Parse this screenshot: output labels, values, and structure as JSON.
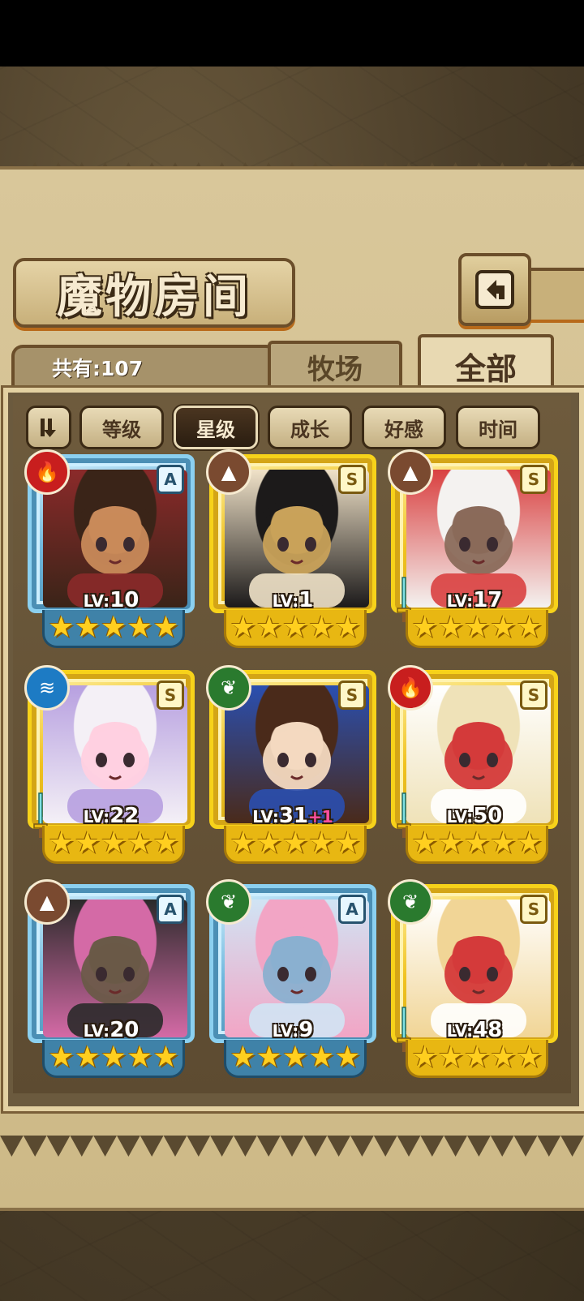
{
  "header": {
    "title": "魔物房间",
    "total_count": "共有:107"
  },
  "tabs": [
    {
      "label": "牧场",
      "active": false
    },
    {
      "label": "全部",
      "active": true
    }
  ],
  "sort_buttons": [
    {
      "label": "等级",
      "active": false
    },
    {
      "label": "星级",
      "active": true
    },
    {
      "label": "成长",
      "active": false
    },
    {
      "label": "好感",
      "active": false
    },
    {
      "label": "时间",
      "active": false
    }
  ],
  "stars_glyph": "★★★★★",
  "level_prefix": "LV:",
  "monsters": [
    {
      "level": "10",
      "bonus": "",
      "rank": "A",
      "element": "fire-icon",
      "frame": "blue",
      "has_weapon": false,
      "palette": [
        "#3a2418",
        "#8b2a2a",
        "#c98a5a"
      ]
    },
    {
      "level": "1",
      "bonus": "",
      "rank": "S",
      "element": "earth-icon",
      "frame": "gold",
      "has_weapon": false,
      "palette": [
        "#1c1a1a",
        "#f0e2c8",
        "#c9a25a"
      ]
    },
    {
      "level": "17",
      "bonus": "",
      "rank": "S",
      "element": "earth-icon",
      "frame": "gold",
      "has_weapon": true,
      "palette": [
        "#f4f2f0",
        "#d94040",
        "#8a6a5a"
      ]
    },
    {
      "level": "22",
      "bonus": "",
      "rank": "S",
      "element": "water-icon",
      "frame": "gold",
      "has_weapon": true,
      "palette": [
        "#f4f0f6",
        "#b7a0e0",
        "#ffd0e0"
      ]
    },
    {
      "level": "31",
      "bonus": "+1",
      "rank": "S",
      "element": "leaf-icon",
      "frame": "gold",
      "has_weapon": false,
      "palette": [
        "#4a2a1a",
        "#2a4fb0",
        "#f3d9c0"
      ]
    },
    {
      "level": "50",
      "bonus": "",
      "rank": "S",
      "element": "fire-icon",
      "frame": "gold",
      "has_weapon": true,
      "palette": [
        "#efe2b8",
        "#ffffff",
        "#d43a3a"
      ]
    },
    {
      "level": "20",
      "bonus": "",
      "rank": "A",
      "element": "earth-icon",
      "frame": "blue",
      "has_weapon": false,
      "palette": [
        "#d46aa6",
        "#2a2a2a",
        "#6a5a48"
      ]
    },
    {
      "level": "9",
      "bonus": "",
      "rank": "A",
      "element": "leaf-icon",
      "frame": "blue",
      "has_weapon": false,
      "palette": [
        "#f2a5c5",
        "#d0e4f4",
        "#8ab0d0"
      ]
    },
    {
      "level": "48",
      "bonus": "",
      "rank": "S",
      "element": "leaf-icon",
      "frame": "gold",
      "has_weapon": true,
      "palette": [
        "#f1d596",
        "#ffffff",
        "#d43a3a"
      ]
    }
  ]
}
